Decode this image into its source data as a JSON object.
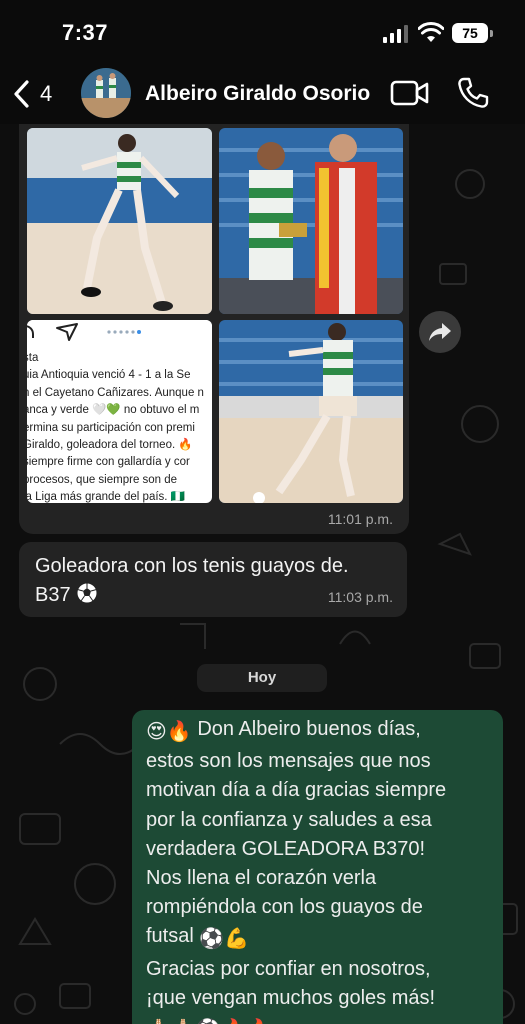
{
  "status_bar": {
    "time": "7:37",
    "battery": "75"
  },
  "header": {
    "back_count": "4",
    "contact_name": "Albeiro Giraldo Osorio"
  },
  "media_message": {
    "post_lines": [
      "sta",
      "uia Antioquia venció 4 - 1 a la Se",
      "n el Cayetano Cañizares. Aunque n",
      "anca y verde 🤍💚 no obtuvo el m",
      "ermina su participación con premi",
      "Giraldo, goleadora del torneo. 🔥",
      "siempre firme con gallardía y cor",
      "procesos, que siempre son de",
      "la Liga más grande del país. 🇳🇬"
    ],
    "time": "11:01 p.m."
  },
  "text_message": {
    "line1": "Goleadora con los tenis guayos de.",
    "line2": "B37",
    "time": "11:03 p.m."
  },
  "date_separator": "Hoy",
  "outgoing_message": {
    "lines": [
      "Don Albeiro buenos días,",
      "estos son los mensajes que nos",
      "motivan día a día gracias siempre",
      "por la confianza y saludes a  esa",
      "verdadera GOLEADORA B370!",
      "Nos llena el corazón verla",
      "rompiéndola con los  guayos  de",
      "futsal",
      "Gracias por confiar en nosotros,",
      "¡que vengan muchos goles más!"
    ],
    "emojis": {
      "line1": "😍🔥",
      "line8": "⚽💪",
      "line11": "🙏🏻🙏🏻⚽🔥🔥"
    }
  },
  "colors": {
    "background": "#0b0b0b",
    "incoming_bubble": "#232323",
    "outgoing_bubble": "#1d4a35"
  },
  "icons": [
    "back-chevron-icon",
    "video-call-icon",
    "phone-icon",
    "forward-icon",
    "soccer-ball-icon"
  ]
}
